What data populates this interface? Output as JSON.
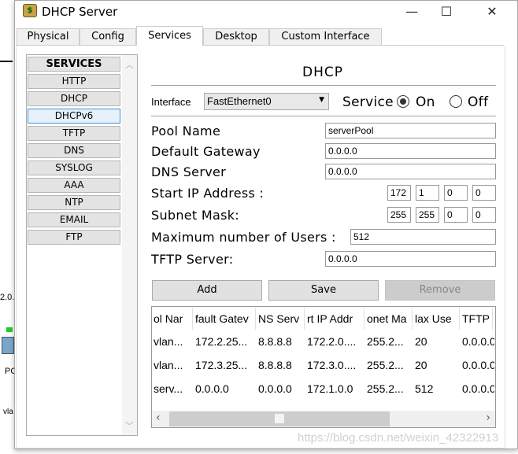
{
  "window": {
    "title": "DHCP Server",
    "minimize": "—",
    "maximize": "☐",
    "close": "✕",
    "icon": "server-app-icon"
  },
  "tabs": [
    {
      "label": "Physical"
    },
    {
      "label": "Config"
    },
    {
      "label": "Services",
      "active": true
    },
    {
      "label": "Desktop"
    },
    {
      "label": "Custom Interface"
    }
  ],
  "services": {
    "header": "SERVICES",
    "items": [
      {
        "label": "HTTP"
      },
      {
        "label": "DHCP"
      },
      {
        "label": "DHCPv6",
        "selected": true
      },
      {
        "label": "TFTP"
      },
      {
        "label": "DNS"
      },
      {
        "label": "SYSLOG"
      },
      {
        "label": "AAA"
      },
      {
        "label": "NTP"
      },
      {
        "label": "EMAIL"
      },
      {
        "label": "FTP"
      }
    ]
  },
  "dhcp": {
    "title": "DHCP",
    "interface_label": "Interface",
    "interface_value": "FastEthernet0",
    "service_label": "Service",
    "on_label": "On",
    "off_label": "Off",
    "service_on": true,
    "pool_name_label": "Pool Name",
    "pool_name": "serverPool",
    "gateway_label": "Default Gateway",
    "gateway": "0.0.0.0",
    "dns_label": "DNS Server",
    "dns": "0.0.0.0",
    "start_ip_label": "Start IP Address :",
    "start_ip": [
      "172",
      "1",
      "0",
      "0"
    ],
    "mask_label": "Subnet Mask:",
    "mask": [
      "255",
      "255",
      "0",
      "0"
    ],
    "max_users_label": "Maximum number of Users :",
    "max_users": "512",
    "tftp_label": "TFTP Server:",
    "tftp": "0.0.0.0",
    "add": "Add",
    "save": "Save",
    "remove": "Remove"
  },
  "table": {
    "headers": [
      "ol Nar",
      "fault Gatev",
      "NS Serv",
      "rt IP Addr",
      "onet Ma",
      "lax Use",
      "TFTP"
    ],
    "rows": [
      [
        "vlan...",
        "172.2.25...",
        "8.8.8.8",
        "172.2.0....",
        "255.2...",
        "20",
        "0.0.0.0"
      ],
      [
        "vlan...",
        "172.3.25...",
        "8.8.8.8",
        "172.3.0....",
        "255.2...",
        "20",
        "0.0.0.0"
      ],
      [
        "serv...",
        "0.0.0.0",
        "0.0.0.0",
        "172.1.0.0",
        "255.2...",
        "512",
        "0.0.0.0"
      ]
    ]
  },
  "background": {
    "frag1": "2.0.",
    "frag2": "PC",
    "frag3": "vla"
  },
  "watermark": "https://blog.csdn.net/weixin_42322913"
}
